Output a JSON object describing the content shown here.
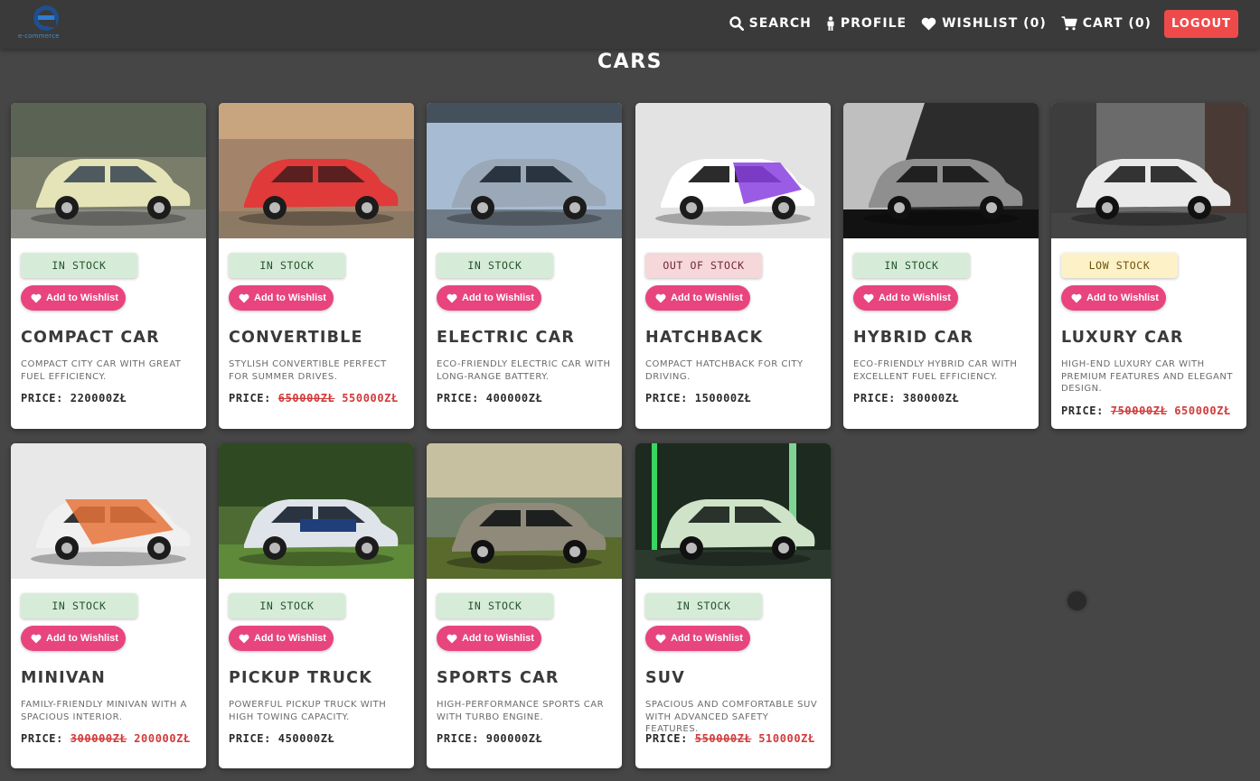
{
  "header": {
    "logo_text": "e-commerce",
    "nav": {
      "search": "SEARCH",
      "profile": "PROFILE",
      "wishlist": "WISHLIST (0)",
      "cart": "CART (0)",
      "logout": "LOGOUT"
    }
  },
  "page_title": "CARS",
  "wishlist_label": "Add to Wishlist",
  "price_label": "PRICE:",
  "colors": {
    "accent_pink": "#e8447e",
    "logout_red": "#ef4a4a",
    "sale_red": "#d23a3a",
    "in_stock_bg": "#d6ecd8",
    "out_of_stock_bg": "#f6d7da",
    "low_stock_bg": "#fdf1c7"
  },
  "products": [
    {
      "name": "COMPACT CAR",
      "status": "IN STOCK",
      "status_type": "in",
      "description": "COMPACT CITY CAR WITH GREAT FUEL EFFICIENCY.",
      "price": "220000ZŁ",
      "old_price": "",
      "image": "compact-car-photo"
    },
    {
      "name": "CONVERTIBLE",
      "status": "IN STOCK",
      "status_type": "in",
      "description": "STYLISH CONVERTIBLE PERFECT FOR SUMMER DRIVES.",
      "price": "550000ZŁ",
      "old_price": "650000ZŁ",
      "image": "convertible-photo"
    },
    {
      "name": "ELECTRIC CAR",
      "status": "IN STOCK",
      "status_type": "in",
      "description": "ECO-FRIENDLY ELECTRIC CAR WITH LONG-RANGE BATTERY.",
      "price": "400000ZŁ",
      "old_price": "",
      "image": "electric-car-photo"
    },
    {
      "name": "HATCHBACK",
      "status": "OUT OF STOCK",
      "status_type": "out",
      "description": "COMPACT HATCHBACK FOR CITY DRIVING.",
      "price": "150000ZŁ",
      "old_price": "",
      "image": "hatchback-photo"
    },
    {
      "name": "HYBRID CAR",
      "status": "IN STOCK",
      "status_type": "in",
      "description": "ECO-FRIENDLY HYBRID CAR WITH EXCELLENT FUEL EFFICIENCY.",
      "price": "380000ZŁ",
      "old_price": "",
      "image": "hybrid-car-photo"
    },
    {
      "name": "LUXURY CAR",
      "status": "LOW STOCK",
      "status_type": "low",
      "description": "HIGH-END LUXURY CAR WITH PREMIUM FEATURES AND ELEGANT DESIGN.",
      "price": "650000ZŁ",
      "old_price": "750000ZŁ",
      "image": "luxury-car-photo"
    },
    {
      "name": "MINIVAN",
      "status": "IN STOCK",
      "status_type": "in",
      "description": "FAMILY-FRIENDLY MINIVAN WITH A SPACIOUS INTERIOR.",
      "price": "200000ZŁ",
      "old_price": "300000ZŁ",
      "image": "minivan-photo"
    },
    {
      "name": "PICKUP TRUCK",
      "status": "IN STOCK",
      "status_type": "in",
      "description": "POWERFUL PICKUP TRUCK WITH HIGH TOWING CAPACITY.",
      "price": "450000ZŁ",
      "old_price": "",
      "image": "pickup-truck-photo"
    },
    {
      "name": "SPORTS CAR",
      "status": "IN STOCK",
      "status_type": "in",
      "description": "HIGH-PERFORMANCE SPORTS CAR WITH TURBO ENGINE.",
      "price": "900000ZŁ",
      "old_price": "",
      "image": "sports-car-photo"
    },
    {
      "name": "SUV",
      "status": "IN STOCK",
      "status_type": "in",
      "description": "SPACIOUS AND COMFORTABLE SUV WITH ADVANCED SAFETY FEATURES.",
      "price": "510000ZŁ",
      "old_price": "550000ZŁ",
      "image": "suv-photo"
    }
  ]
}
